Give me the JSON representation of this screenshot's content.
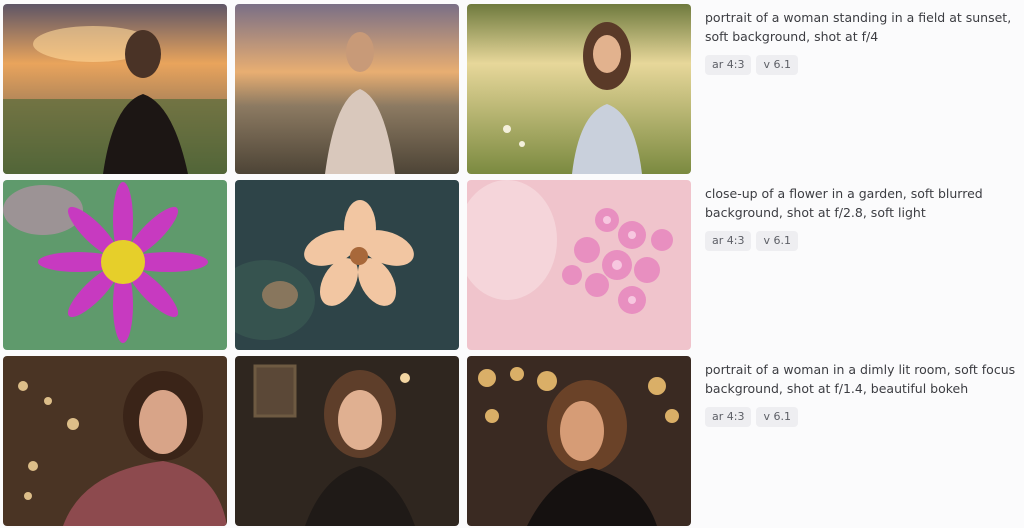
{
  "jobs": [
    {
      "prompt": "portrait of a woman standing in a field at sunset, soft background, shot at f/4",
      "params": [
        {
          "label": "ar 4:3"
        },
        {
          "label": "v 6.1"
        }
      ]
    },
    {
      "prompt": "close-up of a flower in a garden, soft blurred background, shot at f/2.8, soft light",
      "params": [
        {
          "label": "ar 4:3"
        },
        {
          "label": "v 6.1"
        }
      ]
    },
    {
      "prompt": "portrait of a woman in a dimly lit room, soft focus background, shot at f/1.4, beautiful bokeh",
      "params": [
        {
          "label": "ar 4:3"
        },
        {
          "label": "v 6.1"
        }
      ]
    }
  ]
}
